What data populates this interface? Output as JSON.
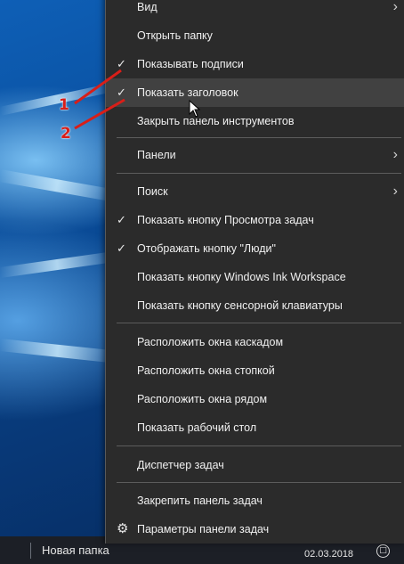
{
  "menu": {
    "items": [
      {
        "label": "Вид",
        "checked": false,
        "submenu": true
      },
      {
        "label": "Открыть папку",
        "checked": false,
        "submenu": false
      },
      {
        "label": "Показывать подписи",
        "checked": true,
        "submenu": false
      },
      {
        "label": "Показать заголовок",
        "checked": true,
        "submenu": false,
        "hovered": true
      },
      {
        "label": "Закрыть панель инструментов",
        "checked": false,
        "submenu": false
      },
      {
        "label": "Панели",
        "checked": false,
        "submenu": true
      },
      {
        "label": "Поиск",
        "checked": false,
        "submenu": true
      },
      {
        "label": "Показать кнопку Просмотра задач",
        "checked": true,
        "submenu": false
      },
      {
        "label": "Отображать кнопку \"Люди\"",
        "checked": true,
        "submenu": false
      },
      {
        "label": "Показать кнопку Windows Ink Workspace",
        "checked": false,
        "submenu": false
      },
      {
        "label": "Показать кнопку сенсорной клавиатуры",
        "checked": false,
        "submenu": false
      },
      {
        "label": "Расположить окна каскадом",
        "checked": false,
        "submenu": false
      },
      {
        "label": "Расположить окна стопкой",
        "checked": false,
        "submenu": false
      },
      {
        "label": "Расположить окна рядом",
        "checked": false,
        "submenu": false
      },
      {
        "label": "Показать рабочий стол",
        "checked": false,
        "submenu": false
      },
      {
        "label": "Диспетчер задач",
        "checked": false,
        "submenu": false
      },
      {
        "label": "Закрепить панель задач",
        "checked": false,
        "submenu": false
      },
      {
        "label": "Параметры панели задач",
        "checked": false,
        "submenu": false,
        "icon": "gear-icon"
      }
    ]
  },
  "glyphs": {
    "check": "✓",
    "chevron": "›",
    "gear": "⚙"
  },
  "annotations": {
    "label_1": "1",
    "label_2": "2",
    "color": "#d91e18"
  },
  "taskbar": {
    "folder_label": "Новая папка",
    "date": "02.03.2018",
    "notification_glyph": "□"
  },
  "colors": {
    "menu_bg": "#2b2b2b",
    "menu_hover": "#414141",
    "menu_text": "#f0f0f0",
    "taskbar_bg": "#1c1f26"
  }
}
